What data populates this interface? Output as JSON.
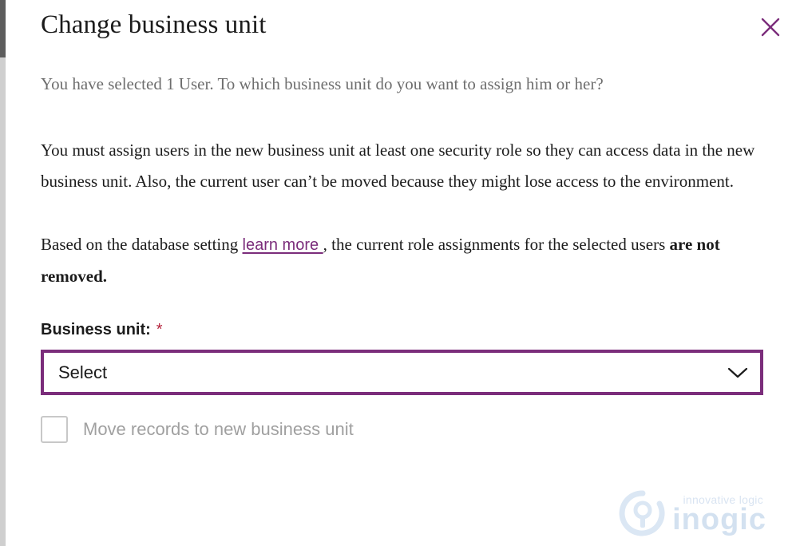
{
  "dialog": {
    "title": "Change business unit",
    "close_label": "Close",
    "close_icon": "close-icon"
  },
  "content": {
    "intro_paragraph": "You have selected 1 User. To which business unit do you want to assign him or her?",
    "body_paragraph": "You must assign users in the new business unit at least one security role so they can access data in the new business unit. Also, the current user can’t be moved because they might lose access to the environment.",
    "note_prefix": "Based on the database setting ",
    "note_link": "learn more ",
    "note_middle": ", the current role assignments for the selected users ",
    "note_emphasis": "are not removed."
  },
  "field": {
    "label": "Business unit:",
    "required_marker": "*",
    "select_value": "Select",
    "select_icon": "chevron-down-icon",
    "options": [
      "Select"
    ]
  },
  "checkbox": {
    "label": "Move records to new business unit",
    "checked": false,
    "disabled": true
  },
  "watermark": {
    "tagline": "innovative logic",
    "wordmark": "inogic"
  },
  "colors": {
    "accent_purple": "#7b2d7b",
    "required_red": "#b5233c",
    "intro_text_gray": "#6e6e6e",
    "body_text": "#1b1b1b",
    "disabled_gray": "#a0a0a0",
    "watermark_blue": "#d3e1f0",
    "scrollbar_thumb": "#5d5d5d",
    "scrollbar_track": "#cfcfcf"
  }
}
